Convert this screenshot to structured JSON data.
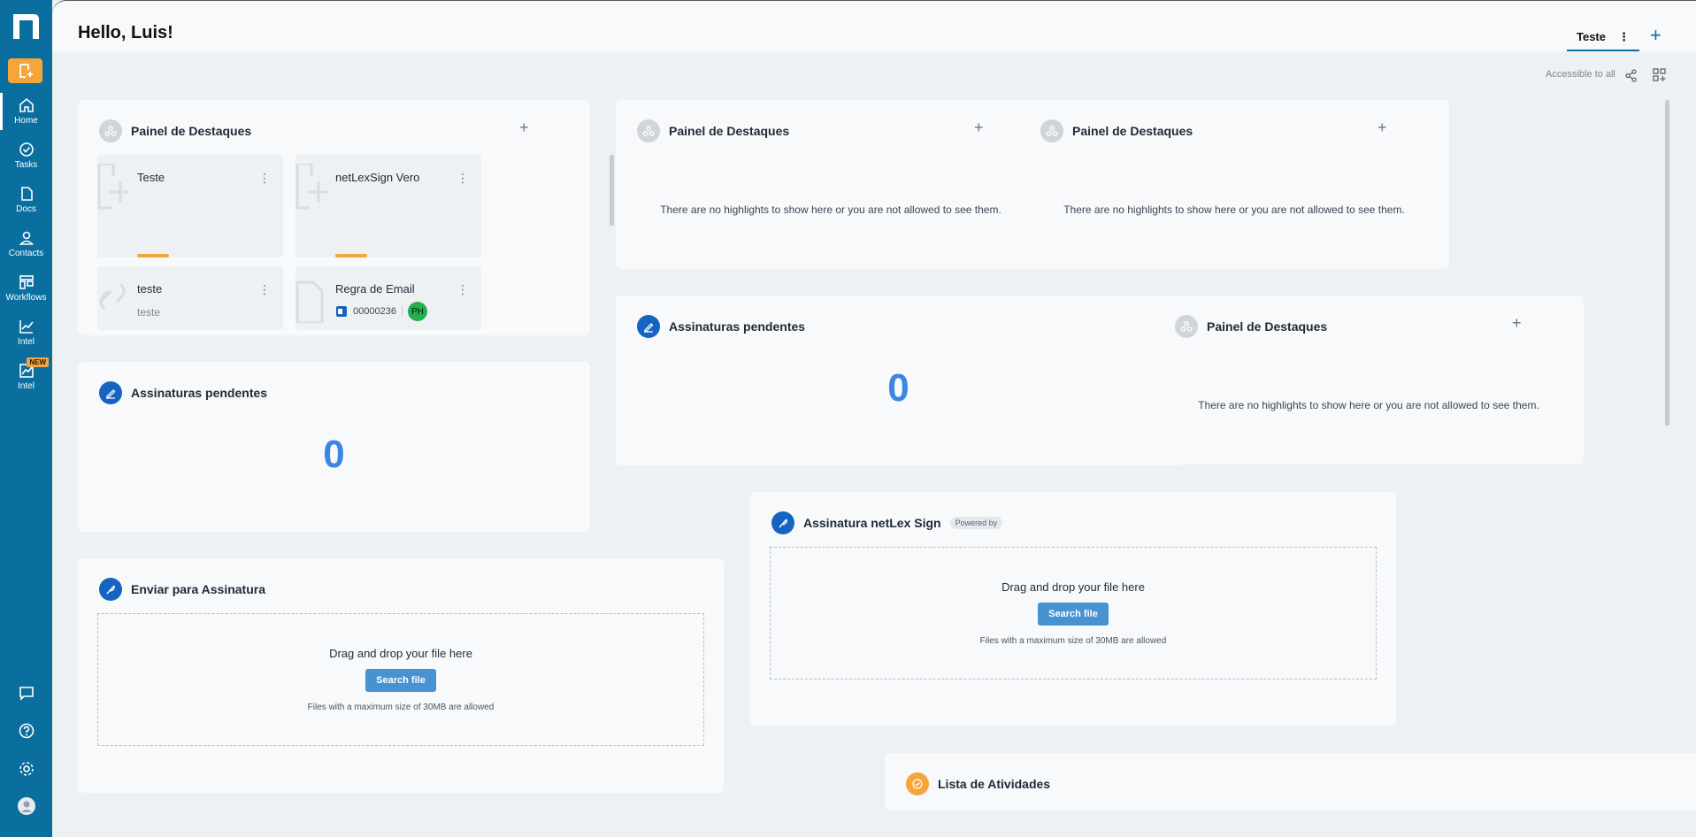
{
  "sidebar": {
    "items": [
      {
        "label": "Home",
        "icon": "home-icon",
        "active": true
      },
      {
        "label": "Tasks",
        "icon": "check-circle-icon"
      },
      {
        "label": "Docs",
        "icon": "document-icon"
      },
      {
        "label": "Contacts",
        "icon": "user-icon"
      },
      {
        "label": "Workflows",
        "icon": "workflow-icon"
      },
      {
        "label": "Intel",
        "icon": "chart-icon"
      },
      {
        "label": "Intel",
        "icon": "chart-new-icon",
        "badge": "NEW"
      }
    ],
    "bottom_icons": [
      "chat-icon",
      "help-icon",
      "settings-icon",
      "avatar-icon"
    ]
  },
  "header": {
    "greeting": "Hello, Luis!",
    "tab": "Teste",
    "accessible": "Accessible to all"
  },
  "highlights_main": {
    "title": "Painel de Destaques",
    "tiles": [
      {
        "title": "Teste"
      },
      {
        "title": "netLexSign Vero"
      },
      {
        "title": "teste",
        "subtitle": "teste"
      },
      {
        "title": "Regra de Email",
        "code": "00000236",
        "avatar": "PH"
      }
    ]
  },
  "highlights_empty": {
    "title": "Painel de Destaques",
    "message": "There are no highlights to show here or you are not allowed to see them."
  },
  "pending": {
    "title": "Assinaturas pendentes",
    "count": "0"
  },
  "send_sign": {
    "title": "Enviar para Assinatura",
    "drop_text": "Drag and drop your file here",
    "button": "Search file",
    "note": "Files with a maximum size of 30MB are allowed"
  },
  "netlex_sign": {
    "title": "Assinatura netLex Sign",
    "powered": "Powered by",
    "drop_text": "Drag and drop your file here",
    "button": "Search file",
    "note": "Files with a maximum size of 30MB are allowed"
  },
  "activities": {
    "title": "Lista de Atividades"
  },
  "colors": {
    "sidebar": "#0a6f9f",
    "accent_orange": "#f5a53a",
    "count_blue": "#3a86e0",
    "button_blue": "#4793d1"
  }
}
